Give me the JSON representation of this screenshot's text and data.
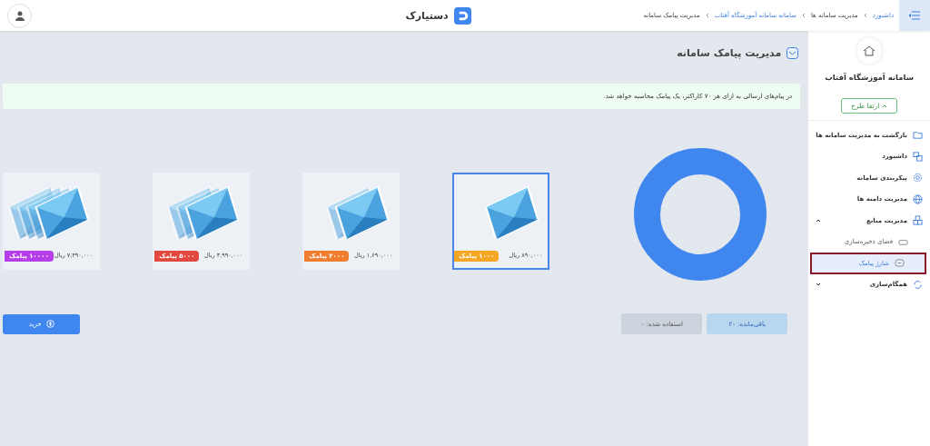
{
  "topbar": {
    "breadcrumbs": [
      {
        "label": "داشبورد",
        "link": true
      },
      {
        "label": "مدیریت سامانه ها",
        "link": false
      },
      {
        "label": "سامانه سامانه آموزشگاه آفتاب",
        "link": true
      },
      {
        "label": "مدیریت پیامک سامانه",
        "link": false
      }
    ],
    "brand": "دستیارک"
  },
  "sidebar": {
    "title": "سامانه آموزشگاه آفتاب",
    "upgrade_button": "ارتقا طرح",
    "items": [
      {
        "label": "بازگشت به مدیریت سامانه ها",
        "selected": false
      },
      {
        "label": "داشبورد",
        "selected": false
      },
      {
        "label": "پیکربندی سامانه",
        "selected": false
      },
      {
        "label": "مدیریت دامنه ها",
        "selected": false
      },
      {
        "label": "مدیریت منابع",
        "selected": false,
        "expanded": true,
        "children": [
          {
            "label": "فضای ذخیره‌سازی",
            "selected": false
          },
          {
            "label": "شارژ پیامک",
            "selected": true
          }
        ]
      },
      {
        "label": "همگام‌سازی",
        "selected": false,
        "expanded": false
      }
    ]
  },
  "page": {
    "title": "مدیریت پیامک سامانه",
    "notice": "در پیام‌های ارسالی به ازای هر ۷۰ کاراکتر، یک پیامک محاسبه خواهد شد.",
    "packages": [
      {
        "price": "۸۹۰,۰۰۰ ریال",
        "badge": "۱۰۰۰ پیامک",
        "color": "#f5a623",
        "selected": true
      },
      {
        "price": "۱,۶۹۰,۰۰۰ ریال",
        "badge": "۲۰۰۰ پیامک",
        "color": "#f07d2e",
        "selected": false
      },
      {
        "price": "۳,۹۹۰,۰۰۰ ریال",
        "badge": "۵۰۰۰ پیامک",
        "color": "#e2483d",
        "selected": false
      },
      {
        "price": "۷,۴۹۰,۰۰۰ ریال",
        "badge": "۱۰۰۰۰ پیامک",
        "color": "#b63ee8",
        "selected": false
      }
    ],
    "remaining": "باقی‌مانده: ۲۰",
    "used": "استفاده شده: ۰",
    "buy_button": "خرید"
  }
}
